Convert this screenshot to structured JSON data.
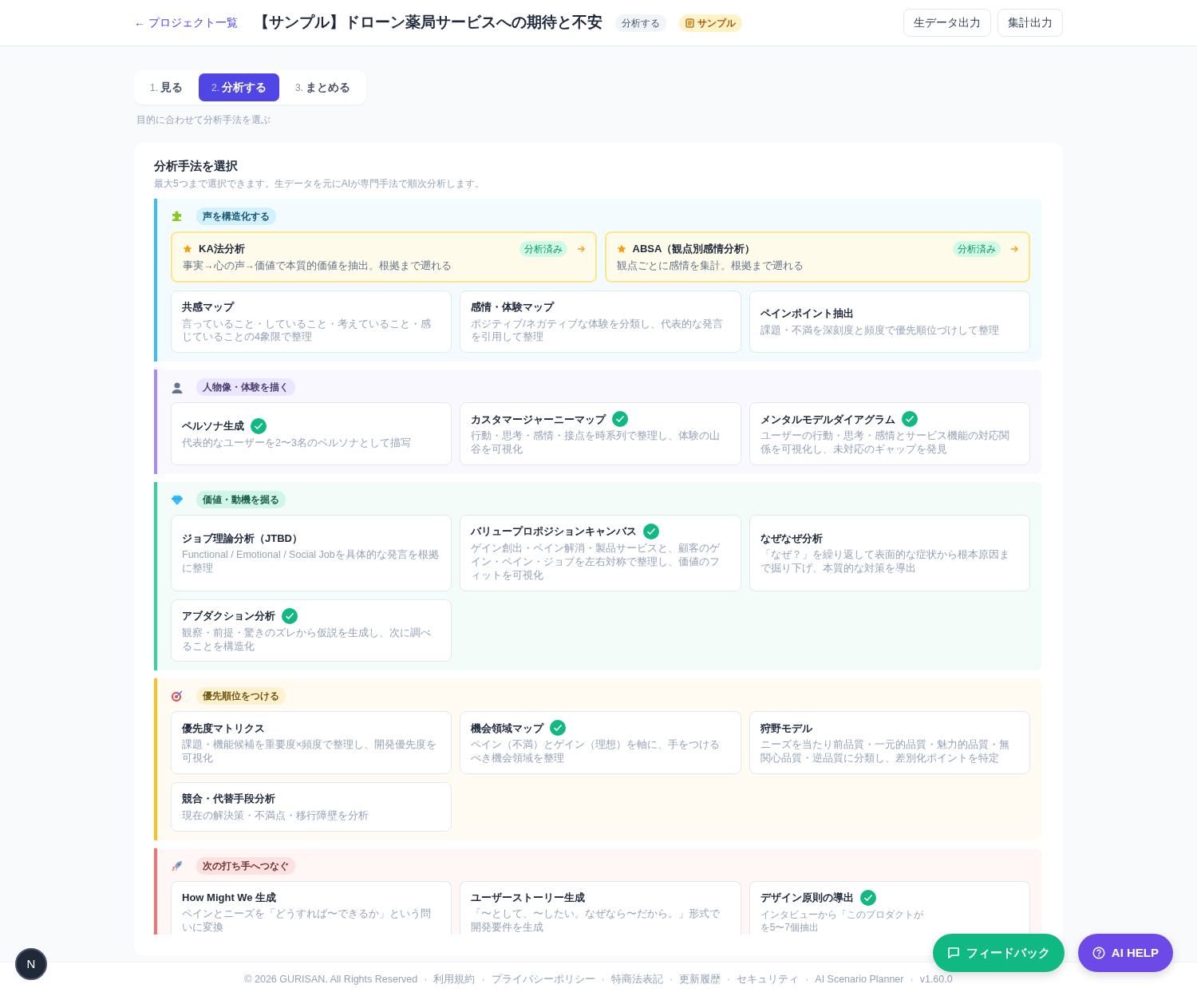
{
  "header": {
    "back_link": "← プロジェクト一覧",
    "title": "【サンプル】ドローン薬局サービスへの期待と不安",
    "stage_badge": "分析する",
    "sample_badge": "サンプル",
    "buttons": [
      "生データ出力",
      "集計出力"
    ]
  },
  "steps": [
    {
      "number": "1.",
      "label": "見る",
      "selected": false
    },
    {
      "number": "2.",
      "label": "分析する",
      "selected": true
    },
    {
      "number": "3.",
      "label": "まとめる",
      "selected": false
    }
  ],
  "step_hint": "目的に合わせて分析手法を選ぶ",
  "panel": {
    "title": "分析手法を選択",
    "subtitle": "最大5つまで選択できます。生データを元にAIが専門手法で順次分析します。"
  },
  "sections": [
    {
      "label": "声を構造化する",
      "color": "#38bdf8",
      "methods": [
        {
          "kind": "featured",
          "title": "KA法分析",
          "desc": "事実→心の声→価値で本質的価値を抽出。根拠まで遡れる",
          "status": "分析済み"
        },
        {
          "kind": "featured",
          "title": "ABSA（観点別感情分析）",
          "desc": "観点ごとに感情を集計。根拠まで遡れる",
          "status": "分析済み"
        },
        {
          "kind": "method",
          "title": "共感マップ",
          "desc": "言っていること・していること・考えていること・感じていることの4象限で整理",
          "done": false
        },
        {
          "kind": "method",
          "title": "感情・体験マップ",
          "desc": "ポジティブ/ネガティブな体験を分類し、代表的な発言を引用して整理",
          "done": false
        },
        {
          "kind": "method",
          "title": "ペインポイント抽出",
          "desc": "課題・不満を深刻度と頻度で優先順位づけして整理",
          "done": false
        }
      ]
    },
    {
      "label": "人物像・体験を描く",
      "color": "#a78bfa",
      "methods": [
        {
          "kind": "method",
          "title": "ペルソナ生成",
          "desc": "代表的なユーザーを2〜3名のペルソナとして描写",
          "done": true
        },
        {
          "kind": "method",
          "title": "カスタマージャーニーマップ",
          "desc": "行動・思考・感情・接点を時系列で整理し、体験の山谷を可視化",
          "done": true
        },
        {
          "kind": "method",
          "title": "メンタルモデルダイアグラム",
          "desc": "ユーザーの行動・思考・感情とサービス機能の対応関係を可視化し、未対応のギャップを発見",
          "done": true
        }
      ]
    },
    {
      "label": "価値・動機を掘る",
      "color": "#34d399",
      "methods": [
        {
          "kind": "method",
          "title": "ジョブ理論分析（JTBD）",
          "desc": "Functional / Emotional / Social Jobを具体的な発言を根拠に整理",
          "done": false
        },
        {
          "kind": "method",
          "title": "バリュープロポジションキャンバス",
          "desc": "ゲイン創出・ペイン解消・製品サービスと、顧客のゲイン・ペイン・ジョブを左右対称で整理し、価値のフィットを可視化",
          "done": true
        },
        {
          "kind": "method",
          "title": "なぜなぜ分析",
          "desc": "「なぜ？」を繰り返して表面的な症状から根本原因まで掘り下げ、本質的な対策を導出",
          "done": false
        },
        {
          "kind": "method",
          "title": "アブダクション分析",
          "desc": "観察・前提・驚きのズレから仮説を生成し、次に調べることを構造化",
          "done": true
        }
      ]
    },
    {
      "label": "優先順位をつける",
      "color": "#fbbf24",
      "methods": [
        {
          "kind": "method",
          "title": "優先度マトリクス",
          "desc": "課題・機能候補を重要度×頻度で整理し、開発優先度を可視化",
          "done": false
        },
        {
          "kind": "method",
          "title": "機会領域マップ",
          "desc": "ペイン（不満）とゲイン（理想）を軸に、手をつけるべき機会領域を整理",
          "done": true
        },
        {
          "kind": "method",
          "title": "狩野モデル",
          "desc": "ニーズを当たり前品質・一元的品質・魅力的品質・無関心品質・逆品質に分類し、差別化ポイントを特定",
          "done": false
        },
        {
          "kind": "method",
          "title": "競合・代替手段分析",
          "desc": "現在の解決策・不満点・移行障壁を分析",
          "done": false
        }
      ]
    },
    {
      "label": "次の打ち手へつなぐ",
      "color": "#f87171",
      "methods": [
        {
          "kind": "method",
          "title": "How Might We 生成",
          "desc": "ペインとニーズを「どうすれば〜できるか」という問いに変換",
          "done": false
        },
        {
          "kind": "method",
          "title": "ユーザーストーリー生成",
          "desc": "「〜として、〜したい。なぜなら〜だから。」形式で開発要件を生成",
          "done": false
        },
        {
          "kind": "method",
          "title": "デザイン原則の導出",
          "desc": [
            "インタビューから「このプロダクトが",
            "を5〜7個抽出"
          ],
          "done": true
        }
      ]
    }
  ],
  "footer": {
    "separator": "·",
    "items": [
      "© 2026 GURISAN. All Rights Reserved",
      "利用規約",
      "プライバシーポリシー",
      "特商法表記",
      "更新履歴",
      "セキュリティ",
      "AI Scenario Planner",
      "v1.60.0"
    ]
  },
  "floating": {
    "feedback": "フィードバック",
    "help": "AI HELP",
    "dev_badge": "N"
  }
}
